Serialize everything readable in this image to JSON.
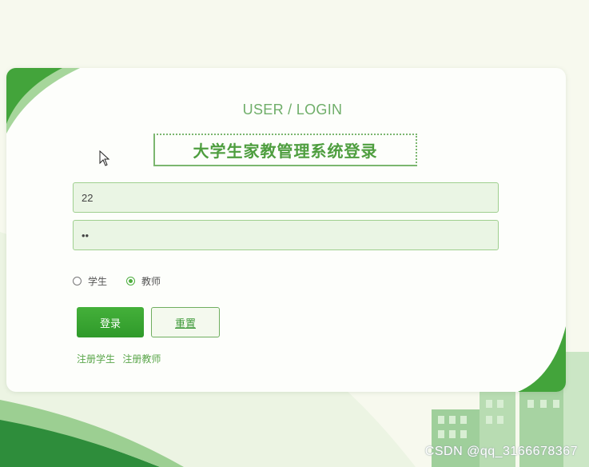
{
  "login": {
    "subtitle": "USER / LOGIN",
    "title": "大学生家教管理系统登录",
    "username_value": "22",
    "password_value": "••",
    "roles": [
      {
        "label": "学生",
        "checked": false
      },
      {
        "label": "教师",
        "checked": true
      }
    ],
    "login_button": "登录",
    "reset_button": "重置",
    "links": [
      "注册学生",
      "注册教师"
    ]
  },
  "watermark": "CSDN @qq_3166678367",
  "colors": {
    "accent": "#4fae3f",
    "accent_dark": "#2f9a2a",
    "field_bg": "#eaf5e4",
    "page_bg": "#f7f9ee"
  }
}
